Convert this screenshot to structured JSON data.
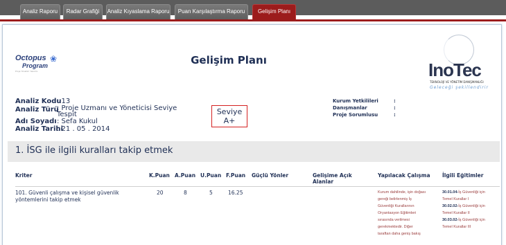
{
  "tabs": [
    {
      "label": "Analiz Raporu",
      "active": false
    },
    {
      "label": "Radar Grafiği",
      "active": false
    },
    {
      "label": "Analiz Kıyaslama Raporu",
      "active": false
    },
    {
      "label": "Puan Karşılaştırma Raporu",
      "active": false
    },
    {
      "label": "Gelişim Planı",
      "active": true
    }
  ],
  "header": {
    "title": "Gelişim Planı",
    "left_logo": {
      "line1a": "Octo",
      "line1b": "pus",
      "line2": "Program",
      "tagline": "Proje Yönetim Yazılımı"
    },
    "right_logo": {
      "word": "InoTec",
      "sub1": "TEKNOLOJİ VE YÖNETİM DANIŞMANLIĞI",
      "sub2": "Geleceği şekillendirir"
    }
  },
  "meta": {
    "code_label": "Analiz Kodu",
    "code_value": ": 13",
    "type_label": "Analiz Türü",
    "type_value_1": ": Proje Uzmanı ve Yöneticisi Seviye",
    "type_value_2": "  Tespit",
    "name_label": "Adı Soyadı",
    "name_value": ": Sefa Kukul",
    "date_label": "Analiz Tarihi",
    "date_value": ": 21 . 05 . 2014"
  },
  "level": {
    "label": "Seviye",
    "value": "A+"
  },
  "responsibles": [
    {
      "key": "Kurum Yetkilileri",
      "value": ":"
    },
    {
      "key": "Danışmanlar",
      "value": ":"
    },
    {
      "key": "Proje Sorumlusu",
      "value": ":"
    }
  ],
  "section": {
    "title": "1. İSG ile ilgili kuralları takip etmek"
  },
  "table": {
    "headers": [
      "Kriter",
      "K.Puan",
      "A.Puan",
      "U.Puan",
      "F.Puan",
      "Güçlü Yönler",
      "Gelişime Açık Alanlar",
      "Yapılacak Çalışma",
      "İlgili Eğitimler"
    ],
    "rows": [
      {
        "criterion_1": "101. Güvenli çalışma ve kişisel güvenlik",
        "criterion_2": "yöntemlerini takip etmek",
        "k": "20",
        "a": "8",
        "u": "5",
        "f": "16.25",
        "work": [
          "Kurum dahilinde, işin doğası",
          "gereği belirlenmiş İş",
          "Güvenliği Kurallarının",
          "Oryantasyon Eğitimleri",
          "sırasında verilmesi",
          "gerekmektedir. Diğer",
          "taraftan daha geniş bakış"
        ],
        "trainings": [
          {
            "code": "30.01.04-",
            "text": "İş Güvenliği için",
            "name": "Temel Kurallar I"
          },
          {
            "code": "30.02.02-",
            "text": "İş Güvenliği için",
            "name": "Temel Kurallar II"
          },
          {
            "code": "30.03.02-",
            "text": "İş Güvenliği için",
            "name": "Temel Kurallar III"
          }
        ]
      }
    ]
  },
  "colors": {
    "accent": "#9c1c1c",
    "text": "#1f2f55",
    "level_border": "#d42020"
  }
}
